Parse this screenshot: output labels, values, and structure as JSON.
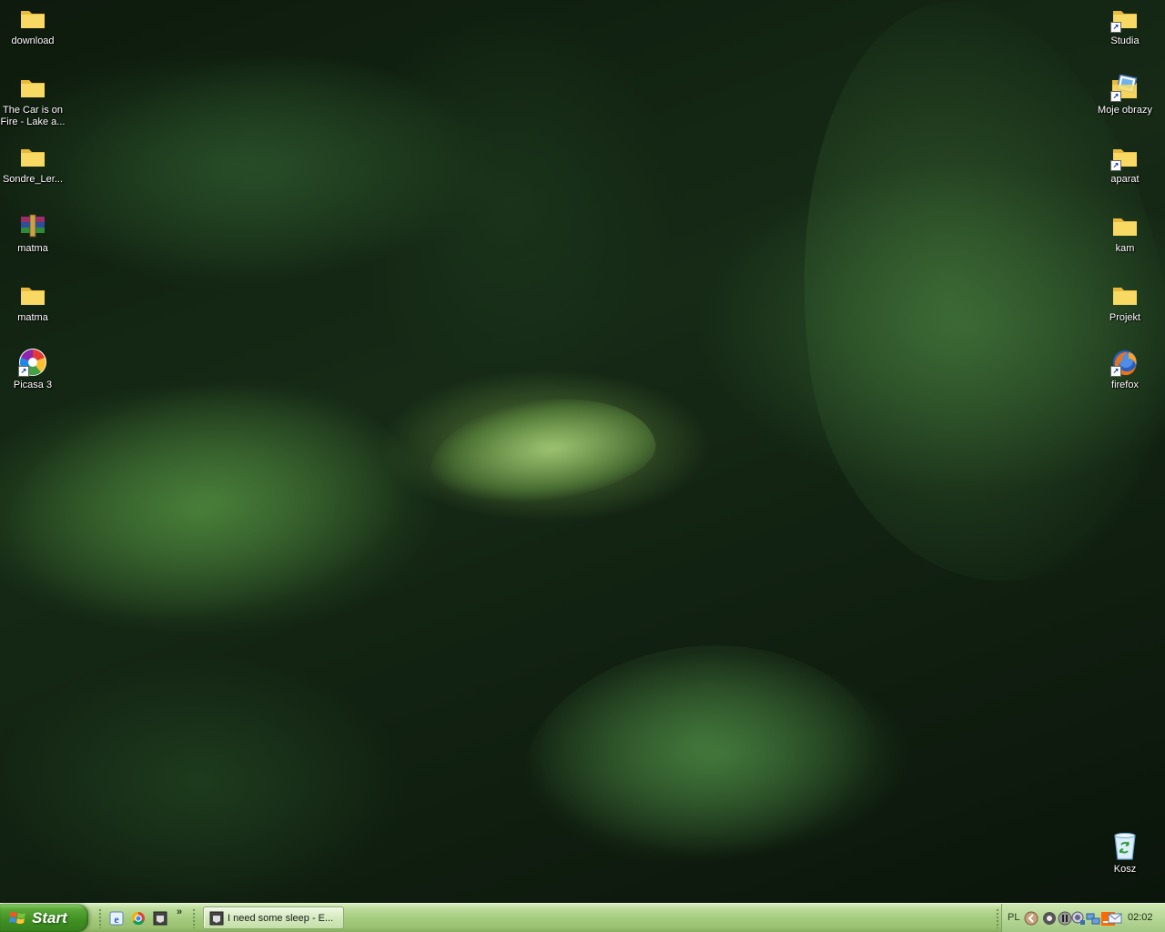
{
  "desktop": {
    "left_icons": [
      {
        "label": "download",
        "icon": "folder-icon"
      },
      {
        "label": "The Car is on Fire - Lake a...",
        "icon": "folder-icon"
      },
      {
        "label": "Sondre_Ler...",
        "icon": "folder-icon"
      },
      {
        "label": "matma",
        "icon": "winrar-archive-icon"
      },
      {
        "label": "matma",
        "icon": "folder-icon"
      },
      {
        "label": "Picasa 3",
        "icon": "picasa-icon"
      }
    ],
    "right_icons": [
      {
        "label": "Studia",
        "icon": "folder-shortcut-icon"
      },
      {
        "label": "Moje obrazy",
        "icon": "my-pictures-icon"
      },
      {
        "label": "aparat",
        "icon": "folder-shortcut-icon"
      },
      {
        "label": "kam",
        "icon": "folder-icon"
      },
      {
        "label": "Projekt",
        "icon": "folder-icon"
      },
      {
        "label": "firefox",
        "icon": "firefox-icon"
      }
    ],
    "recycle_bin": {
      "label": "Kosz",
      "icon": "recycle-bin-icon"
    }
  },
  "taskbar": {
    "start_label": "Start",
    "quick_launch": [
      "internet-explorer-icon",
      "chrome-icon",
      "app-icon"
    ],
    "chevron": "»",
    "task_item": {
      "label": "I need some sleep - E...",
      "icon": "app-window-icon"
    },
    "tray": {
      "language": "PL",
      "clock": "02:02",
      "icons": [
        "tray-expand-icon",
        "tray-app-icon",
        "tray-media-icon",
        "tray-network-icon",
        "tray-connection-icon",
        "tray-orange-icon",
        "tray-mail-icon"
      ]
    }
  },
  "colors": {
    "taskbar_green": "#a6cc80",
    "start_green": "#3f8f22",
    "folder_yellow": "#f5d24a"
  }
}
